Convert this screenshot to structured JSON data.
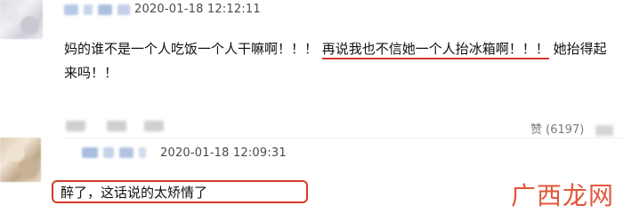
{
  "comments": [
    {
      "timestamp": "2020-01-18 12:12:11",
      "text_before": "妈的谁不是一个人吃饭一个人干嘛啊！！！",
      "text_highlight": "再说我也不信她一个人抬冰箱啊！！！",
      "text_after": "她抬得起来吗！！",
      "like_label": "赞 (6197)"
    },
    {
      "timestamp": "2020-01-18 12:09:31",
      "text": "醉了，这话说的太矫情了"
    }
  ],
  "watermark": {
    "text": "广西龙网"
  },
  "colors": {
    "highlight": "#d83a2a",
    "timestamp": "#4a4a4a",
    "like": "#7a7a7a",
    "watermark": "#e2573a"
  }
}
